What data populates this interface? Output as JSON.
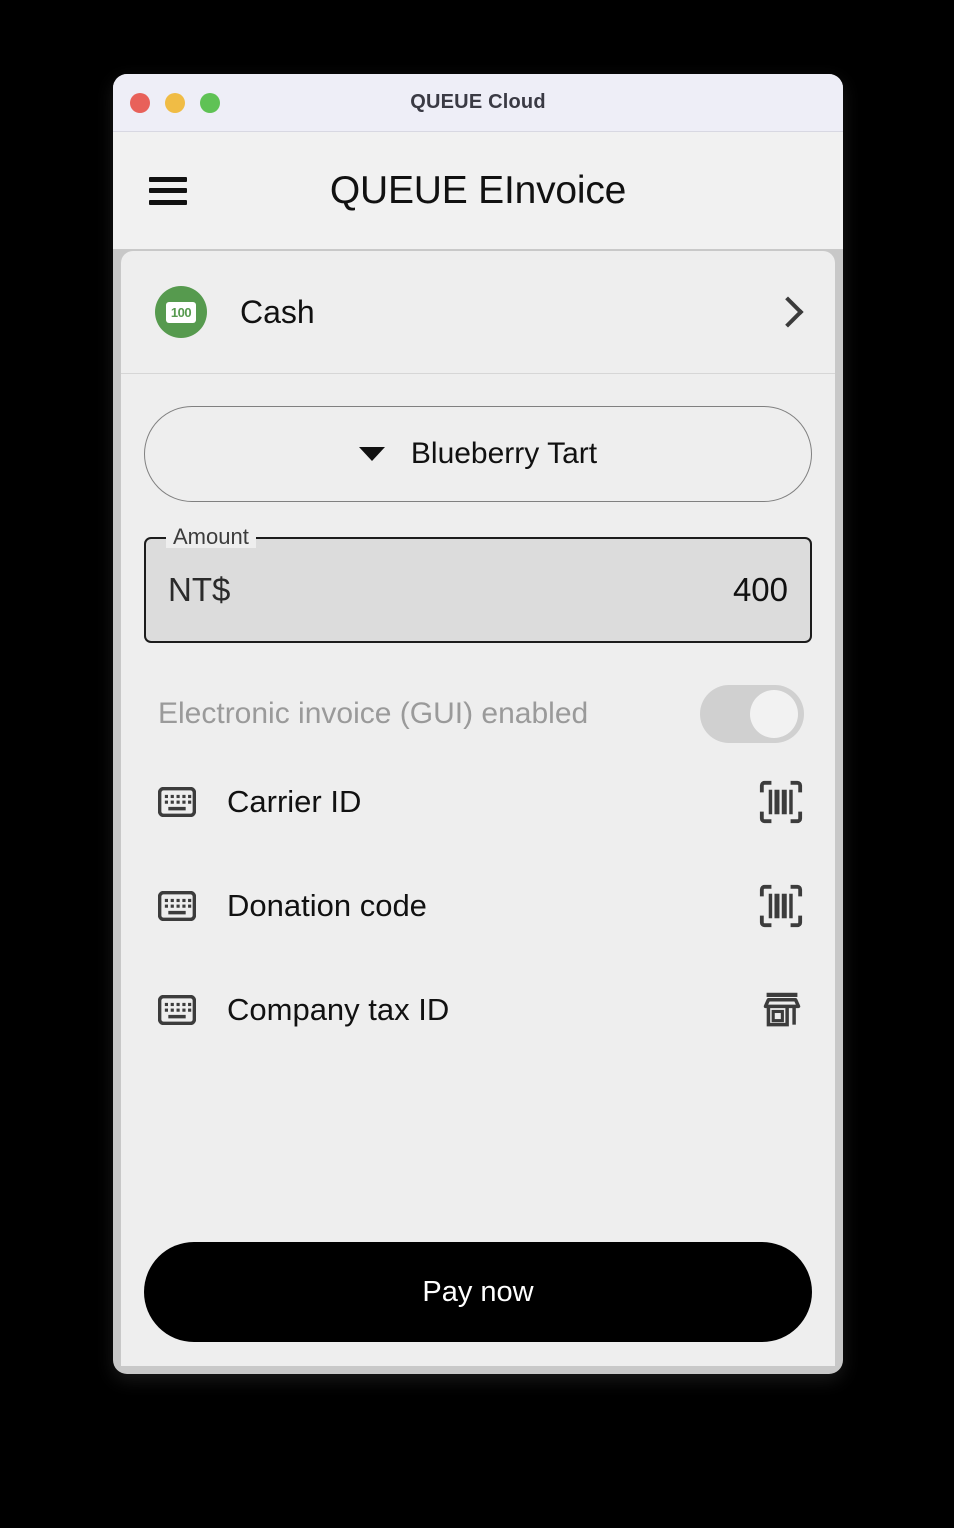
{
  "window": {
    "title": "QUEUE Cloud",
    "traffic_lights": [
      {
        "name": "close",
        "color": "#e8615a"
      },
      {
        "name": "minimize",
        "color": "#f0bc45"
      },
      {
        "name": "maximize",
        "color": "#5fc255"
      }
    ]
  },
  "app_header": {
    "menu_icon": "hamburger-menu-icon",
    "title": "QUEUE EInvoice"
  },
  "payment_method": {
    "icon": "money-icon",
    "icon_text": "100",
    "icon_color": "#569a4e",
    "label": "Cash",
    "chevron": "chevron-right-icon"
  },
  "item_select": {
    "caret": "caret-down-icon",
    "value": "Blueberry Tart"
  },
  "amount": {
    "legend": "Amount",
    "currency": "NT$",
    "value": "400"
  },
  "einvoice_toggle": {
    "label": "Electronic invoice (GUI) enabled",
    "state": "on",
    "disabled": true
  },
  "entries": [
    {
      "left_icon": "keyboard-icon",
      "label": "Carrier ID",
      "right_icon": "barcode-scan-icon"
    },
    {
      "left_icon": "keyboard-icon",
      "label": "Donation code",
      "right_icon": "barcode-scan-icon"
    },
    {
      "left_icon": "keyboard-icon",
      "label": "Company tax ID",
      "right_icon": "storefront-icon"
    }
  ],
  "pay_button": {
    "label": "Pay now"
  }
}
